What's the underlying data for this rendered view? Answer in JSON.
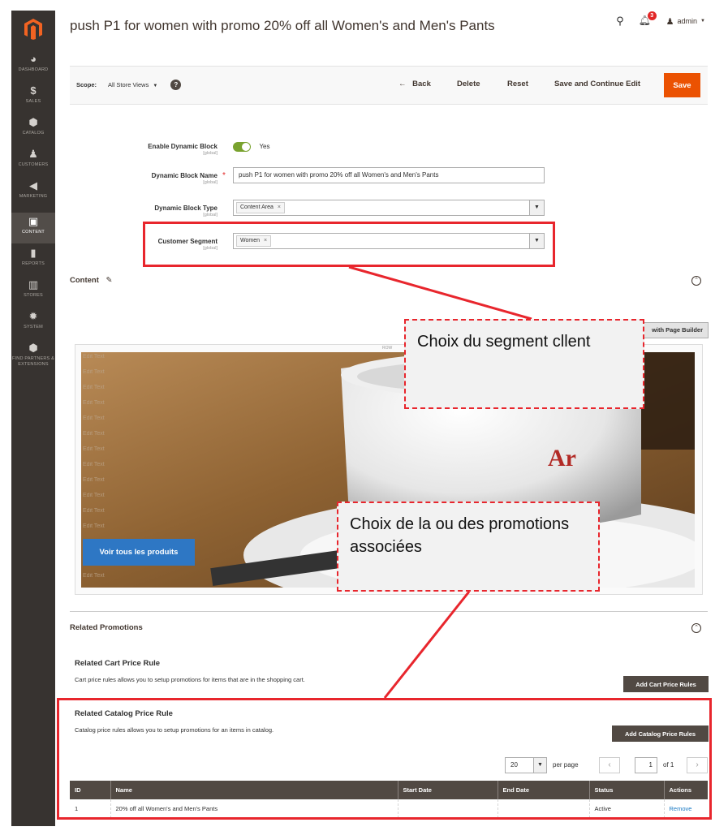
{
  "sidebar": {
    "items": [
      {
        "label": "DASHBOARD",
        "icon": "speedometer-icon"
      },
      {
        "label": "SALES",
        "icon": "dollar-icon"
      },
      {
        "label": "CATALOG",
        "icon": "cube-icon"
      },
      {
        "label": "CUSTOMERS",
        "icon": "person-icon"
      },
      {
        "label": "MARKETING",
        "icon": "megaphone-icon"
      },
      {
        "label": "CONTENT",
        "icon": "layout-icon"
      },
      {
        "label": "REPORTS",
        "icon": "bar-chart-icon"
      },
      {
        "label": "STORES",
        "icon": "store-icon"
      },
      {
        "label": "SYSTEM",
        "icon": "gear-icon"
      },
      {
        "label": "FIND PARTNERS & EXTENSIONS",
        "icon": "box-icon"
      }
    ],
    "active": "CONTENT"
  },
  "header": {
    "title": "push P1 for women with promo 20% off all Women's and Men's Pants",
    "notifications": "3",
    "user": "admin"
  },
  "toolbar": {
    "scope_label": "Scope:",
    "scope_value": "All Store Views",
    "back": "Back",
    "delete": "Delete",
    "reset": "Reset",
    "save_continue": "Save and Continue Edit",
    "save": "Save"
  },
  "form": {
    "enable": {
      "label": "Enable Dynamic Block",
      "scope": "[global]",
      "value": "Yes"
    },
    "name": {
      "label": "Dynamic Block Name",
      "scope": "[global]",
      "value": "push P1 for women with promo 20% off all Women's and Men's Pants"
    },
    "type": {
      "label": "Dynamic Block Type",
      "scope": "[global]",
      "value": "Content Area"
    },
    "segment": {
      "label": "Customer Segment",
      "scope": "[global]",
      "value": "Women"
    }
  },
  "content": {
    "title": "Content",
    "page_builder_btn": "with Page Builder",
    "row_tag": "ROW",
    "edit_text": "Edit Text",
    "cta": "Voir tous les produits"
  },
  "annotations": {
    "segment": "Choix du segment cllent",
    "promo": "Choix de la ou des promotions associées"
  },
  "related": {
    "title": "Related Promotions",
    "cart": {
      "title": "Related Cart Price Rule",
      "desc": "Cart price rules allows you to setup promotions for items that are in the shopping cart.",
      "button": "Add Cart Price Rules"
    },
    "catalog": {
      "title": "Related Catalog Price Rule",
      "desc": "Catalog price rules allows you to setup promotions for an items in catalog.",
      "button": "Add Catalog Price Rules"
    }
  },
  "pager": {
    "per_page_value": "20",
    "per_page_label": "per page",
    "page": "1",
    "of": "of 1"
  },
  "grid": {
    "columns": [
      "ID",
      "Name",
      "Start Date",
      "End Date",
      "Status",
      "Actions"
    ],
    "rows": [
      {
        "id": "1",
        "name": "20% off all Women's and Men's Pants",
        "start": "",
        "end": "",
        "status": "Active",
        "action": "Remove"
      }
    ]
  },
  "colors": {
    "accent": "#eb5202",
    "annotation": "#e8262d",
    "sidebar": "#373330",
    "cta": "#2e77c4"
  }
}
